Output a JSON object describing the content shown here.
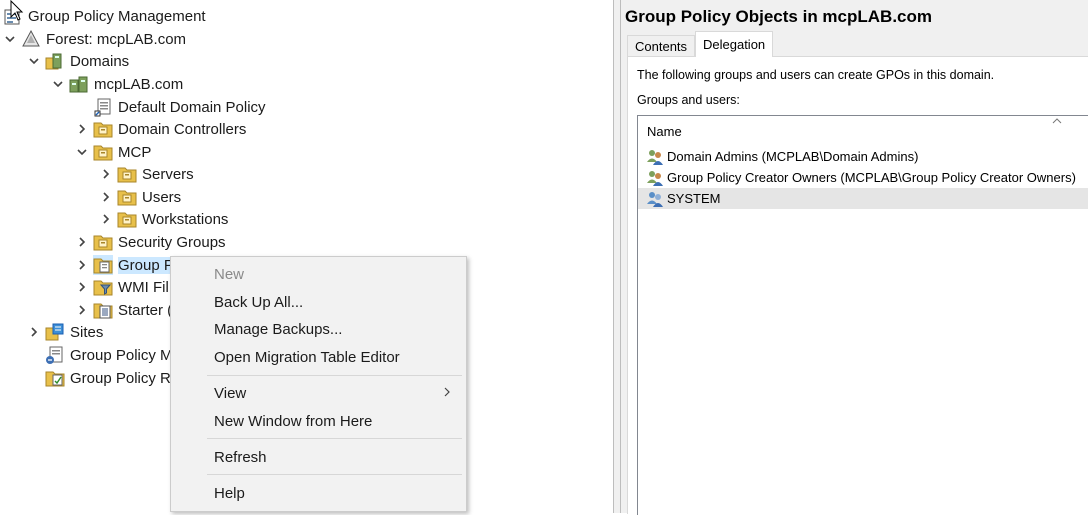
{
  "tree": {
    "root": "Group Policy Management",
    "forest": "Forest: mcpLAB.com",
    "domains": "Domains",
    "domain": "mcpLAB.com",
    "default_policy": "Default Domain Policy",
    "domain_controllers": "Domain Controllers",
    "mcp": "MCP",
    "servers": "Servers",
    "users": "Users",
    "workstations": "Workstations",
    "security_groups": "Security Groups",
    "group_policy_objects": "Group P",
    "wmi_filters": "WMI Fil",
    "starter_gpos": "Starter (",
    "sites": "Sites",
    "gp_modeling": "Group Policy M",
    "gp_results": "Group Policy Re"
  },
  "right": {
    "title": "Group Policy Objects in mcpLAB.com",
    "tabs": [
      "Contents",
      "Delegation"
    ],
    "active_tab": "Delegation",
    "description": "The following groups and users can create GPOs in this domain.",
    "groups_label": "Groups and users:",
    "column": "Name",
    "rows": [
      "Domain Admins (MCPLAB\\Domain Admins)",
      "Group Policy Creator Owners (MCPLAB\\Group Policy Creator Owners)",
      "SYSTEM"
    ],
    "selected_row": "SYSTEM"
  },
  "context_menu": {
    "new": "New",
    "backup_all": "Back Up All...",
    "manage_backups": "Manage Backups...",
    "open_migration": "Open Migration Table Editor",
    "view": "View",
    "new_window": "New Window from Here",
    "refresh": "Refresh",
    "help": "Help"
  },
  "colors": {
    "selection": "#cce8ff",
    "folder": "#e8c04a",
    "menu_bg": "#f2f2f2",
    "pane_bg": "#f0f0f0"
  }
}
